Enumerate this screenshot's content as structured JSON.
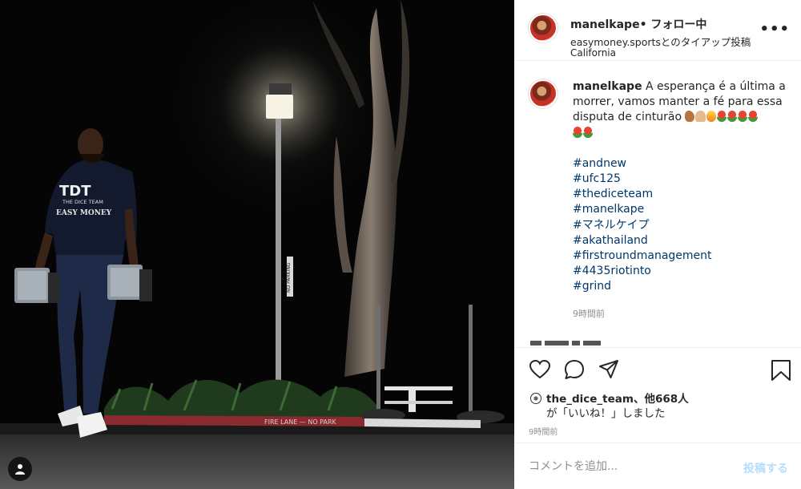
{
  "header": {
    "username": "manelkape",
    "follow_status": "• フォロー中",
    "paid_partnership": "easymoney.sportsとのタイアップ投稿",
    "location": "California",
    "more_label": "•••"
  },
  "photo": {
    "shirt_brand": "TDT",
    "shirt_team": "THE DICE TEAM",
    "shirt_slogan": "EASY MONEY",
    "curb_text": "FIRE LANE — NO PARK",
    "pole_text": "NO PARKING"
  },
  "caption": {
    "username": "manelkape",
    "text": "A esperança é a última a morrer, vamos manter a fé para essa disputa de cinturão",
    "emojis": [
      "arm",
      "pray",
      "fire",
      "rose",
      "rose",
      "rose",
      "rose",
      "rose",
      "rose"
    ],
    "hashtags": [
      "#andnew",
      "#ufc125",
      "#thediceteam",
      "#manelkape",
      "#マネルケイプ",
      "#akathailand",
      "#firstroundmanagement",
      "#4435riotinto",
      "#grind"
    ],
    "time": "9時間前"
  },
  "actions": {
    "like_icon": "heart-icon",
    "comment_icon": "comment-icon",
    "share_icon": "paper-plane-icon",
    "save_icon": "bookmark-icon"
  },
  "likes": {
    "liked_by": "the_dice_team",
    "and_others": "、他668人",
    "suffix": "が「いいね！」しました"
  },
  "post_time": "9時間前",
  "comment_box": {
    "placeholder": "コメントを追加...",
    "post_label": "投稿する"
  },
  "colors": {
    "link_blue": "#00376b",
    "post_button_disabled": "#b2dffc",
    "meta_gray": "#8e8e8e"
  }
}
